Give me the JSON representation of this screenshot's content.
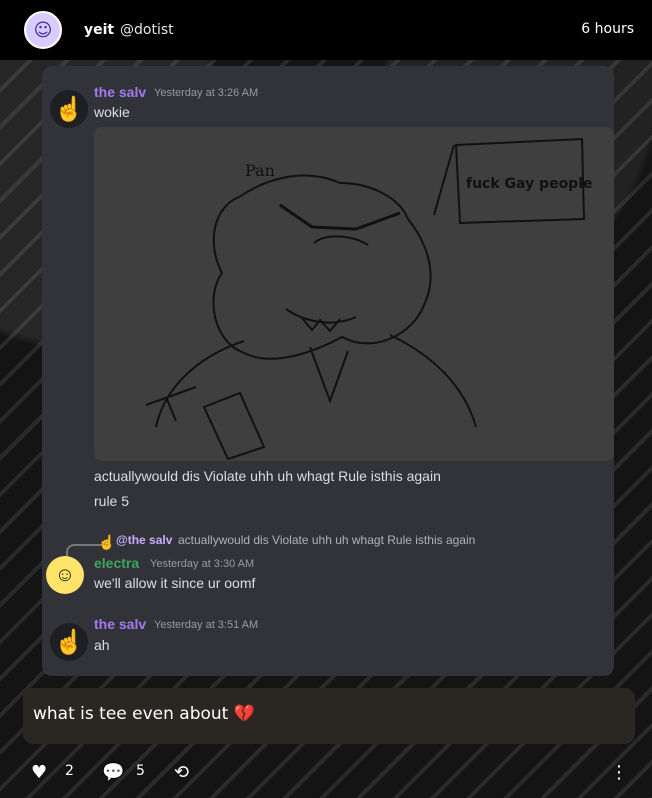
{
  "post": {
    "author_name": "yeit",
    "author_handle": "@dotist",
    "age": "6 hours",
    "caption": "what is tee even about",
    "caption_emoji": "💔"
  },
  "conversation": {
    "messages": [
      {
        "user": "the salv",
        "time": "Yesterday at 3:26 AM",
        "text": "wokie"
      },
      {
        "user": "the salv",
        "text_1": "actuallywould dis Violate uhh uh whagt Rule isthis again",
        "text_2": "rule 5"
      },
      {
        "reply_mention": "@the salv",
        "reply_text": "actuallywould dis Violate uhh uh whagt Rule isthis again",
        "user": "electra",
        "time": "Yesterday at 3:30 AM",
        "text": "we'll allow it since ur oomf"
      },
      {
        "user": "the salv",
        "time": "Yesterday at 3:51 AM",
        "text": "ah"
      }
    ],
    "image_texts": {
      "name": "Pan",
      "sign": "fuck Gay people"
    }
  },
  "footer": {
    "likes": "2",
    "comments": "5"
  },
  "colors": {
    "salv": "#a57af0",
    "electra": "#3ba55d"
  },
  "icons": {
    "avatar": "ghost-icon",
    "like": "heart-icon",
    "comment": "comment-icon",
    "reblog": "reblog-icon",
    "more": "more-vertical-icon"
  }
}
